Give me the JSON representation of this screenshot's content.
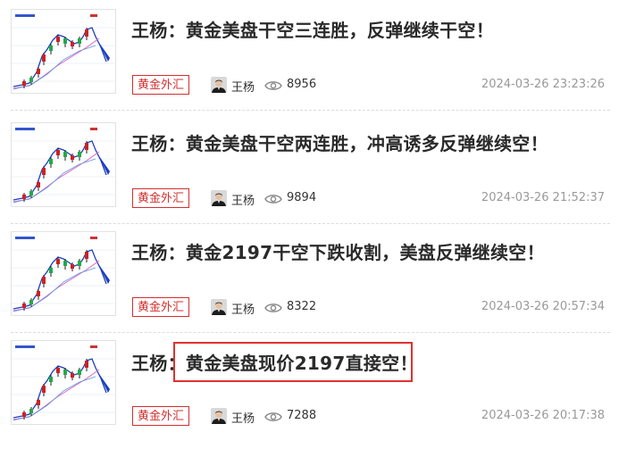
{
  "articles": [
    {
      "title": "王杨：黄金美盘干空三连胜，反弹继续干空！",
      "author": "王杨",
      "category": "黄金外汇",
      "views": "8956",
      "date": "2024-03-26 23:23:26"
    },
    {
      "title": "王杨：黄金美盘干空两连胜，冲高诱多反弹继续空！",
      "author": "王杨",
      "category": "黄金外汇",
      "views": "9894",
      "date": "2024-03-26 21:52:37"
    },
    {
      "title": "王杨：黄金2197干空下跌收割，美盘反弹继续空！",
      "author": "王杨",
      "category": "黄金外汇",
      "views": "8322",
      "date": "2024-03-26 20:57:34"
    },
    {
      "title_prefix": "王杨：",
      "title_highlight": "黄金美盘现价2197直接空！",
      "author": "王杨",
      "category": "黄金外汇",
      "views": "7288",
      "date": "2024-03-26 20:17:38"
    }
  ],
  "colors": {
    "tag": "#d32f2f",
    "highlight_box": "#e0312f",
    "title": "#2a2a2a",
    "date": "#999999",
    "chart_line": "#1a3fbf",
    "ma_pink": "#e060c0"
  },
  "icons": {
    "views": "eye-icon",
    "author": "avatar"
  }
}
